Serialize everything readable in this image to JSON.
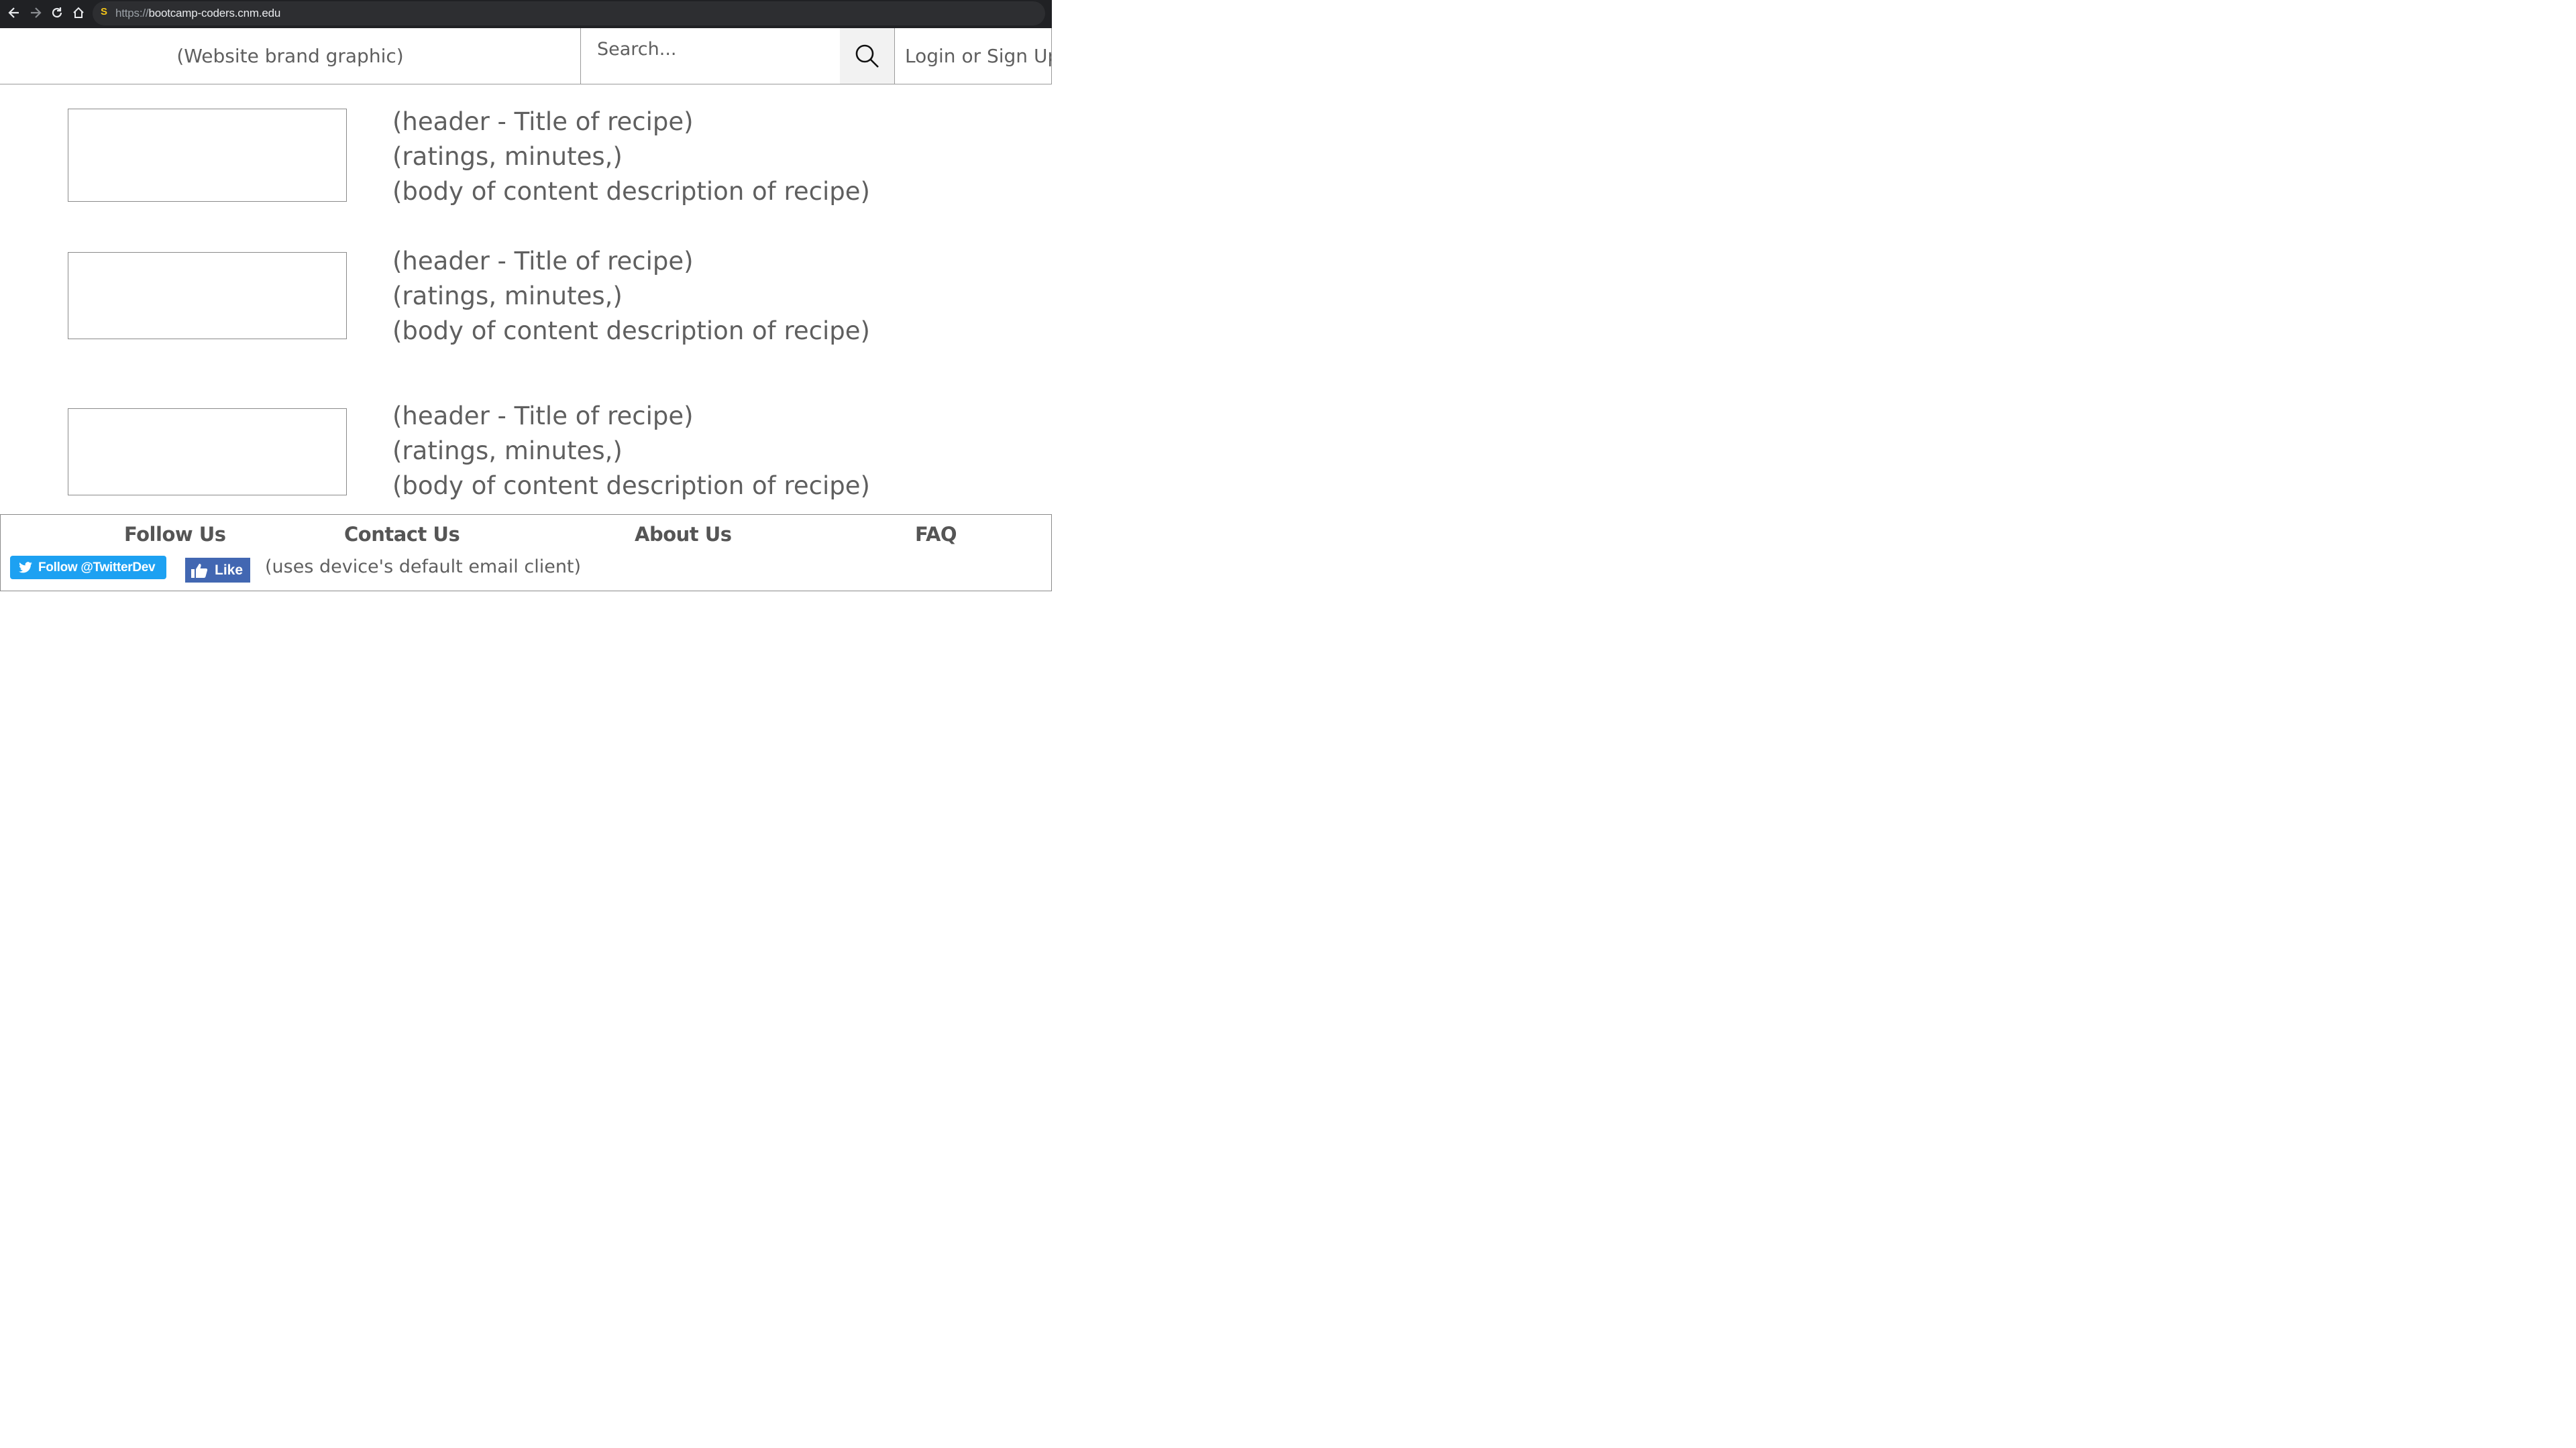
{
  "browser": {
    "url_scheme": "https://",
    "url_host": "bootcamp-coders.cnm.edu",
    "site_icon": "S"
  },
  "header": {
    "brand": "(Website brand graphic)",
    "search_placeholder": "Search...",
    "login": "Login or Sign Up"
  },
  "recipes": [
    {
      "title": "(header - Title of recipe)",
      "meta": "(ratings, minutes,)",
      "body": "(body of content description of recipe)"
    },
    {
      "title": "(header - Title of recipe)",
      "meta": "(ratings, minutes,)",
      "body": "(body of content description of recipe)"
    },
    {
      "title": "(header - Title of recipe)",
      "meta": "(ratings, minutes,)",
      "body": "(body of content description of recipe)"
    }
  ],
  "footer": {
    "follow_us": "Follow Us",
    "contact_us": "Contact Us",
    "about_us": "About Us",
    "faq": "FAQ",
    "twitter_button": "Follow @TwitterDev",
    "facebook_button": "Like",
    "email_note": "(uses device's default email client)"
  },
  "colors": {
    "chrome": "#202124",
    "twitter": "#1da1f2",
    "facebook": "#4267b2",
    "text": "#5f5f5f"
  }
}
